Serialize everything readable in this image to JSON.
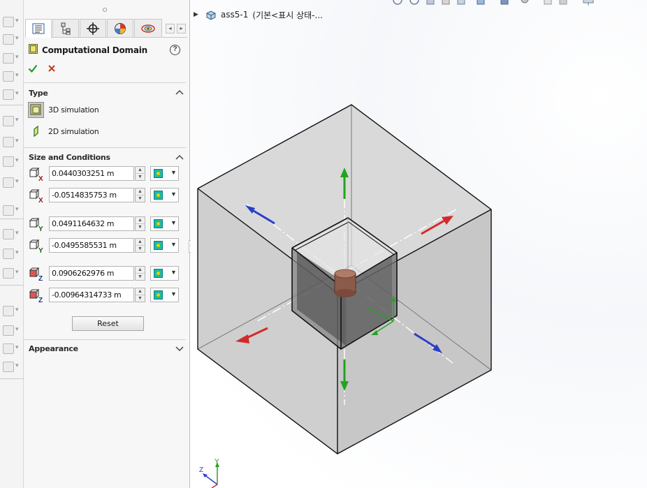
{
  "document": {
    "assembly_name": "ass5-1",
    "configuration": "(기본<표시 상태-..."
  },
  "property_manager": {
    "feature_title": "Computational Domain",
    "tabs": [
      "feature-manager",
      "property-manager",
      "configuration-manager",
      "display-manager",
      "flow-simulation-analysis-tree"
    ],
    "type_section": {
      "title": "Type",
      "options": [
        {
          "label": "3D simulation",
          "selected": true
        },
        {
          "label": "2D simulation",
          "selected": false
        }
      ]
    },
    "size_section": {
      "title": "Size and Conditions",
      "rows": [
        {
          "axis": "x",
          "bound": "max",
          "value": "0.0440303251 m"
        },
        {
          "axis": "x",
          "bound": "min",
          "value": "-0.0514835753 m"
        },
        {
          "axis": "y",
          "bound": "max",
          "value": "0.0491164632 m"
        },
        {
          "axis": "y",
          "bound": "min",
          "value": "-0.0495585531 m"
        },
        {
          "axis": "z",
          "bound": "max",
          "value": "0.0906262976 m"
        },
        {
          "axis": "z",
          "bound": "min",
          "value": "-0.00964314733 m"
        }
      ],
      "reset_label": "Reset"
    },
    "appearance_section": {
      "title": "Appearance"
    }
  },
  "triad": {
    "y_label": "Y",
    "z_label": "Z"
  },
  "colors": {
    "x_axis": "#d52a2a",
    "y_axis": "#22a41f",
    "z_axis": "#2a3fc7",
    "domain_fill": "#d7d7d7",
    "domain_edge": "#111111",
    "part_fill": "#5a5a5a"
  }
}
